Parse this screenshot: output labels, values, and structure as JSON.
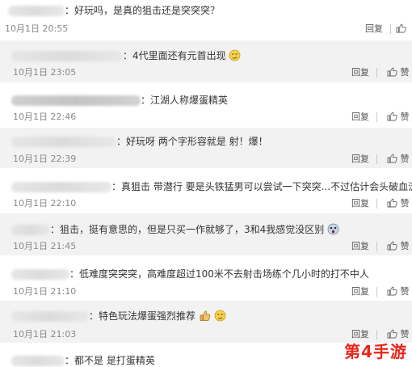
{
  "actions": {
    "reply_label": "回复",
    "like_label": "赞"
  },
  "comments": [
    {
      "text": "：好玩吗，是真的狙击还是突突突？",
      "time": "10月1日 20:55"
    },
    {
      "text": "：4代里面还有元首出现",
      "time": "10月1日 23:05",
      "emoji": "smirk-face-emoji"
    },
    {
      "text": "：江湖人称爆蛋精英",
      "time": "10月1日 22:46"
    },
    {
      "text": "：好玩呀  两个字形容就是  射！爆！",
      "time": "10月1日 22:39"
    },
    {
      "text": "：真狙击 带潜行 要是头铁猛男可以尝试一下突突...不过估计会头破血流",
      "time": "10月1日 22:10"
    },
    {
      "text": "：狙击，挺有意思的，但是只买一作就够了，3和4我感觉没区别",
      "time": "10月1日 21:45",
      "emoji": "shocked-face-emoji"
    },
    {
      "text": "：低难度突突突，高难度超过100米不去射击场练个几小时的打不中人",
      "time": "10月1日 21:10"
    },
    {
      "text": "：特色玩法爆蛋强烈推荐",
      "time": "10月1日 21:03",
      "emoji": "thumbs-up-emoji, smirk-face-emoji"
    },
    {
      "text": "：都不是 是打蛋精英",
      "time": ""
    }
  ],
  "watermark": {
    "text": "第4手游",
    "color": "#e8261c"
  }
}
